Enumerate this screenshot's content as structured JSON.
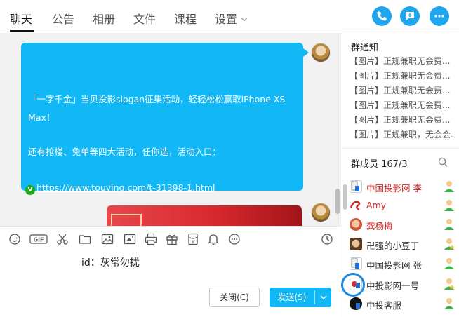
{
  "tabs": [
    {
      "label": "聊天"
    },
    {
      "label": "公告"
    },
    {
      "label": "相册"
    },
    {
      "label": "文件"
    },
    {
      "label": "课程"
    },
    {
      "label": "设置"
    }
  ],
  "header_icons": [
    "phone-icon",
    "message-plus-icon",
    "more-icon"
  ],
  "message": {
    "lines": [
      "「一字千金」当贝投影slogan征集活动，轻轻松松赢取iPhone XS",
      "Max！",
      "还有抢楼、免单等四大活动，任你选，活动入口：",
      "https://www.touying.com/t-31398-1.html"
    ],
    "badge": "V"
  },
  "toolbar_icons": [
    "emoji-icon",
    "gif-icon",
    "scissors-icon",
    "folder-icon",
    "image-icon",
    "screenshot-icon",
    "printer-icon",
    "gift-icon",
    "red-packet-icon",
    "bell-icon",
    "more-dots-icon",
    "history-clock-icon"
  ],
  "toolbar_gif_label": "GIF",
  "input": {
    "text": "id：灰常勿扰"
  },
  "buttons": {
    "close": "关闭(C)",
    "send": "发送(S)"
  },
  "notices": {
    "title": "群通知",
    "items": [
      "【图片】正规兼职无会费...",
      "【图片】正规兼职无会费...",
      "【图片】正规兼职无会费...",
      "【图片】正规兼职无会费...",
      "【图片】正规兼职无会费...",
      "【图片】正规兼职，无会会..."
    ]
  },
  "members": {
    "title": "群成员 167/3",
    "list": [
      {
        "name": "中国投影网 李",
        "color": "#d42a2a"
      },
      {
        "name": "Amy",
        "color": "#d42a2a"
      },
      {
        "name": "龚杨梅",
        "color": "#d42a2a"
      },
      {
        "name": "卍强的小豆丁",
        "color": "#333333"
      },
      {
        "name": "中国投影网 张",
        "color": "#333333"
      },
      {
        "name": "中投影网一号",
        "color": "#333333"
      },
      {
        "name": "中投客服",
        "color": "#333333"
      }
    ]
  },
  "colors": {
    "accent": "#12b7f5",
    "header_button": "#20a5ef",
    "red_name": "#d42a2a"
  }
}
